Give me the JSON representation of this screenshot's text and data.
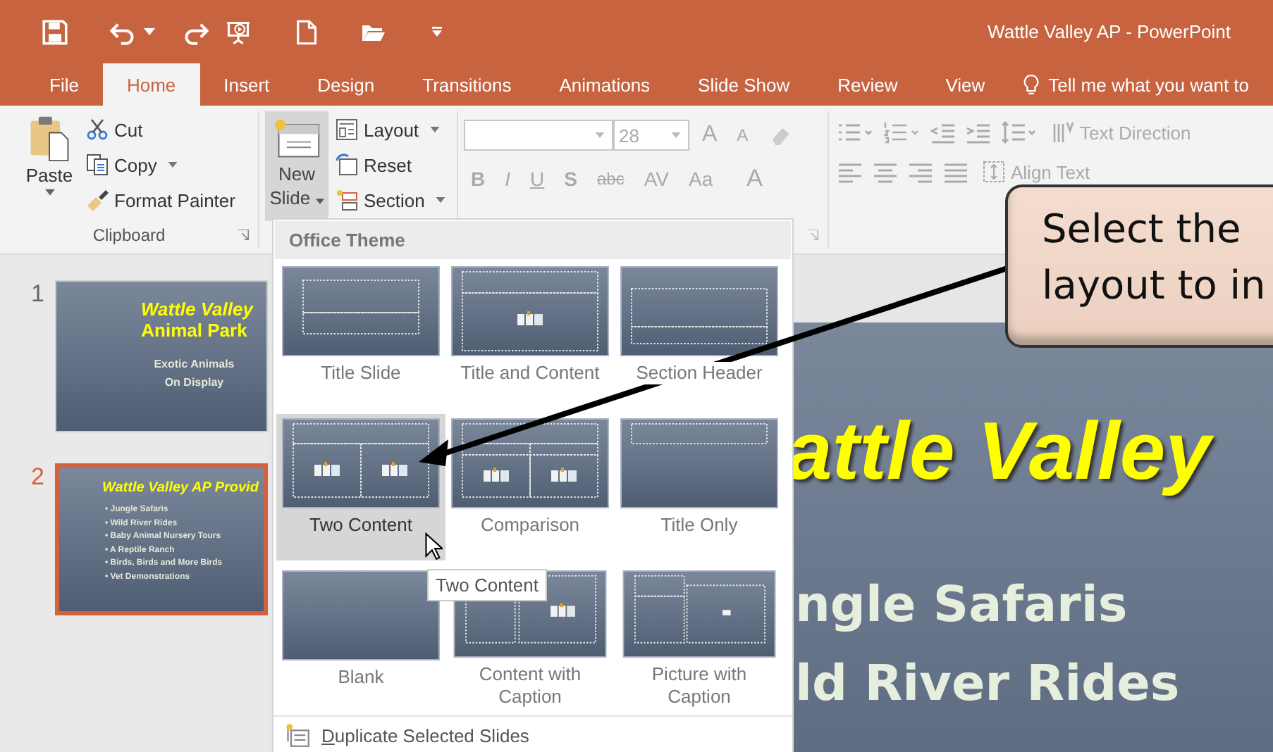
{
  "window": {
    "title": "Wattle Valley AP - PowerPoint"
  },
  "tabs": [
    {
      "label": "File",
      "selected": false
    },
    {
      "label": "Home",
      "selected": true
    },
    {
      "label": "Insert",
      "selected": false
    },
    {
      "label": "Design",
      "selected": false
    },
    {
      "label": "Transitions",
      "selected": false
    },
    {
      "label": "Animations",
      "selected": false
    },
    {
      "label": "Slide Show",
      "selected": false
    },
    {
      "label": "Review",
      "selected": false
    },
    {
      "label": "View",
      "selected": false
    }
  ],
  "tell_me": "Tell me what you want to",
  "ribbon": {
    "clipboard": {
      "paste": "Paste",
      "cut": "Cut",
      "copy": "Copy",
      "format_painter": "Format Painter",
      "label": "Clipboard"
    },
    "slides": {
      "new_slide": "New",
      "new_slide_2": "Slide",
      "pressed": true,
      "layout": "Layout",
      "reset": "Reset",
      "section": "Section"
    },
    "font": {
      "size": "28",
      "grow": "A",
      "shrink": "A",
      "tools": [
        "B",
        "I",
        "U",
        "S",
        "abc",
        "AV",
        "Aa",
        "A"
      ]
    },
    "paragraph": {
      "text_direction": "Text Direction",
      "align_text": "Align Text"
    }
  },
  "slide_pane": [
    {
      "number": "1",
      "selected": false,
      "title": "Wattle Valley",
      "title_2": "Animal Park",
      "lines": [
        "Exotic Animals",
        "On Display"
      ]
    },
    {
      "number": "2",
      "selected": true,
      "title": "Wattle Valley AP Provid",
      "bullets": [
        "• Jungle Safaris",
        "• Wild River Rides",
        "• Baby Animal Nursery Tours",
        "• A Reptile Ranch",
        "• Birds, Birds and More Birds",
        "• Vet Demonstrations"
      ]
    }
  ],
  "layout_gallery": {
    "heading": "Office Theme",
    "layouts": [
      {
        "name": "Title Slide",
        "kind": "title",
        "selected": false
      },
      {
        "name": "Title and Content",
        "kind": "title-content",
        "selected": false
      },
      {
        "name": "Section Header",
        "kind": "section",
        "selected": false
      },
      {
        "name": "Two Content",
        "kind": "two",
        "selected": true
      },
      {
        "name": "Comparison",
        "kind": "comparison",
        "selected": false
      },
      {
        "name": "Title Only",
        "kind": "title-only",
        "selected": false
      },
      {
        "name": "Blank",
        "kind": "blank",
        "selected": false
      },
      {
        "name": "Content with Caption",
        "kind": "content-caption",
        "selected": false
      },
      {
        "name": "Picture with Caption",
        "kind": "picture-caption",
        "selected": false
      }
    ],
    "tooltip": "Two Content",
    "footer": "Duplicate Selected Slides"
  },
  "slide": {
    "title": "attle Valley",
    "bullets": [
      "ngle Safaris",
      "ld River Rides"
    ]
  },
  "callout": {
    "lines": [
      "Select the",
      "layout to in"
    ]
  }
}
